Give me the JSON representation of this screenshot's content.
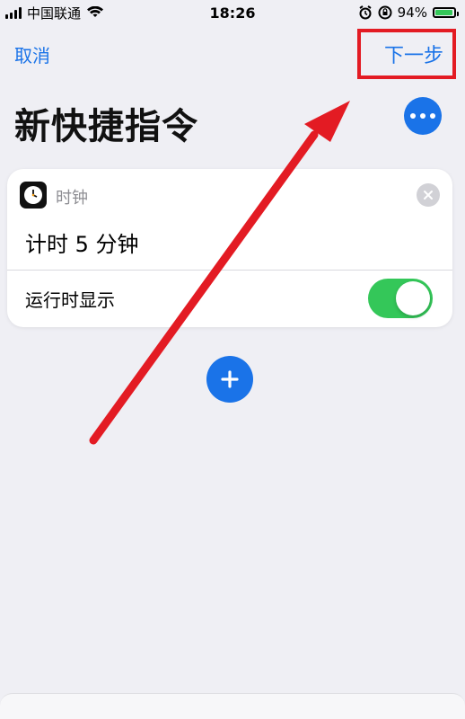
{
  "status_bar": {
    "carrier": "中国联通",
    "time": "18:26",
    "battery_percent": "94%",
    "battery_level": 0.94
  },
  "header": {
    "cancel_label": "取消",
    "next_label": "下一步"
  },
  "page": {
    "title": "新快捷指令"
  },
  "action_card": {
    "app_name": "时钟",
    "action_label": "计时 5 分钟",
    "toggle_label": "运行时显示",
    "toggle_on": true
  },
  "icons": {
    "more": "ellipsis-icon",
    "add": "plus-icon",
    "close": "close-icon",
    "app": "clock-app-icon",
    "wifi": "wifi-icon",
    "alarm": "alarm-icon",
    "lock_rotation": "rotation-lock-icon",
    "battery": "battery-icon"
  },
  "colors": {
    "accent": "#1a73e8",
    "toggle_on": "#34c759",
    "annotation": "#e31b23"
  }
}
